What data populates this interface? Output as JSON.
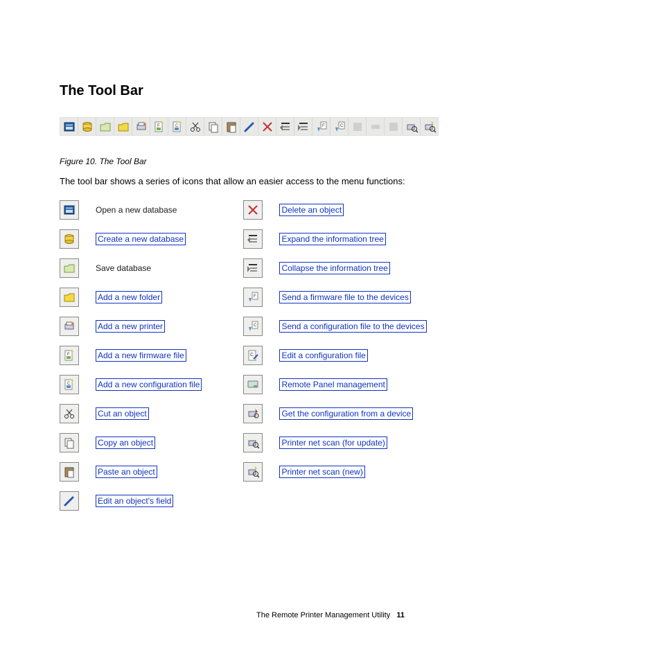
{
  "heading": "The Tool Bar",
  "figcap": "Figure 10. The Tool Bar",
  "intro": "The tool bar shows a series of icons that allow an easier access to the menu functions:",
  "left": [
    {
      "icon": "open-db-icon",
      "text": "Open a new database",
      "link": false
    },
    {
      "icon": "create-db-icon",
      "text": "Create a new database",
      "link": true
    },
    {
      "icon": "save-db-icon",
      "text": "Save database",
      "link": false
    },
    {
      "icon": "add-folder-icon",
      "text": "Add a new folder",
      "link": true
    },
    {
      "icon": "add-printer-icon",
      "text": "Add a new printer",
      "link": true
    },
    {
      "icon": "add-firmware-icon",
      "text": "Add a new firmware file",
      "link": true
    },
    {
      "icon": "add-config-icon",
      "text": "Add a new configuration file",
      "link": true
    },
    {
      "icon": "cut-icon",
      "text": "Cut an object",
      "link": true
    },
    {
      "icon": "copy-icon",
      "text": "Copy an object",
      "link": true
    },
    {
      "icon": "paste-icon",
      "text": "Paste an object",
      "link": true
    },
    {
      "icon": "edit-field-icon",
      "text": "Edit an object's field",
      "link": true
    }
  ],
  "right": [
    {
      "icon": "delete-icon",
      "text": "Delete an object",
      "link": true
    },
    {
      "icon": "expand-icon",
      "text": "Expand the information tree",
      "link": true
    },
    {
      "icon": "collapse-icon",
      "text": "Collapse the information tree",
      "link": true
    },
    {
      "icon": "send-firmware-icon",
      "text": "Send a firmware file to the devices",
      "link": true
    },
    {
      "icon": "send-config-icon",
      "text": "Send a configuration file to the devices",
      "link": true
    },
    {
      "icon": "edit-config-icon",
      "text": "Edit a configuration file",
      "link": true
    },
    {
      "icon": "remote-panel-icon",
      "text": "Remote Panel management",
      "link": true
    },
    {
      "icon": "get-config-icon",
      "text": "Get the configuration from a device",
      "link": true
    },
    {
      "icon": "net-scan-update-icon",
      "text": "Printer net scan (for update)",
      "link": true
    },
    {
      "icon": "net-scan-new-icon",
      "text": "Printer net scan (new)",
      "link": true
    }
  ],
  "footer_text": "The Remote Printer Management Utility",
  "footer_page": "11"
}
